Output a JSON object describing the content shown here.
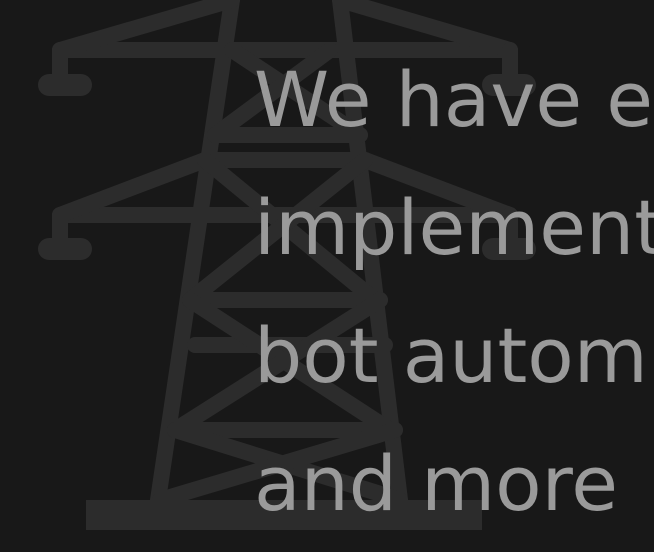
{
  "illustration": {
    "icon": "power-pylon-icon",
    "color": "#2c2c2c"
  },
  "headline": {
    "lines": [
      "We have e",
      "implement",
      "bot autom",
      "and more"
    ],
    "color": "#9a9a9a"
  },
  "background_color": "#181818"
}
